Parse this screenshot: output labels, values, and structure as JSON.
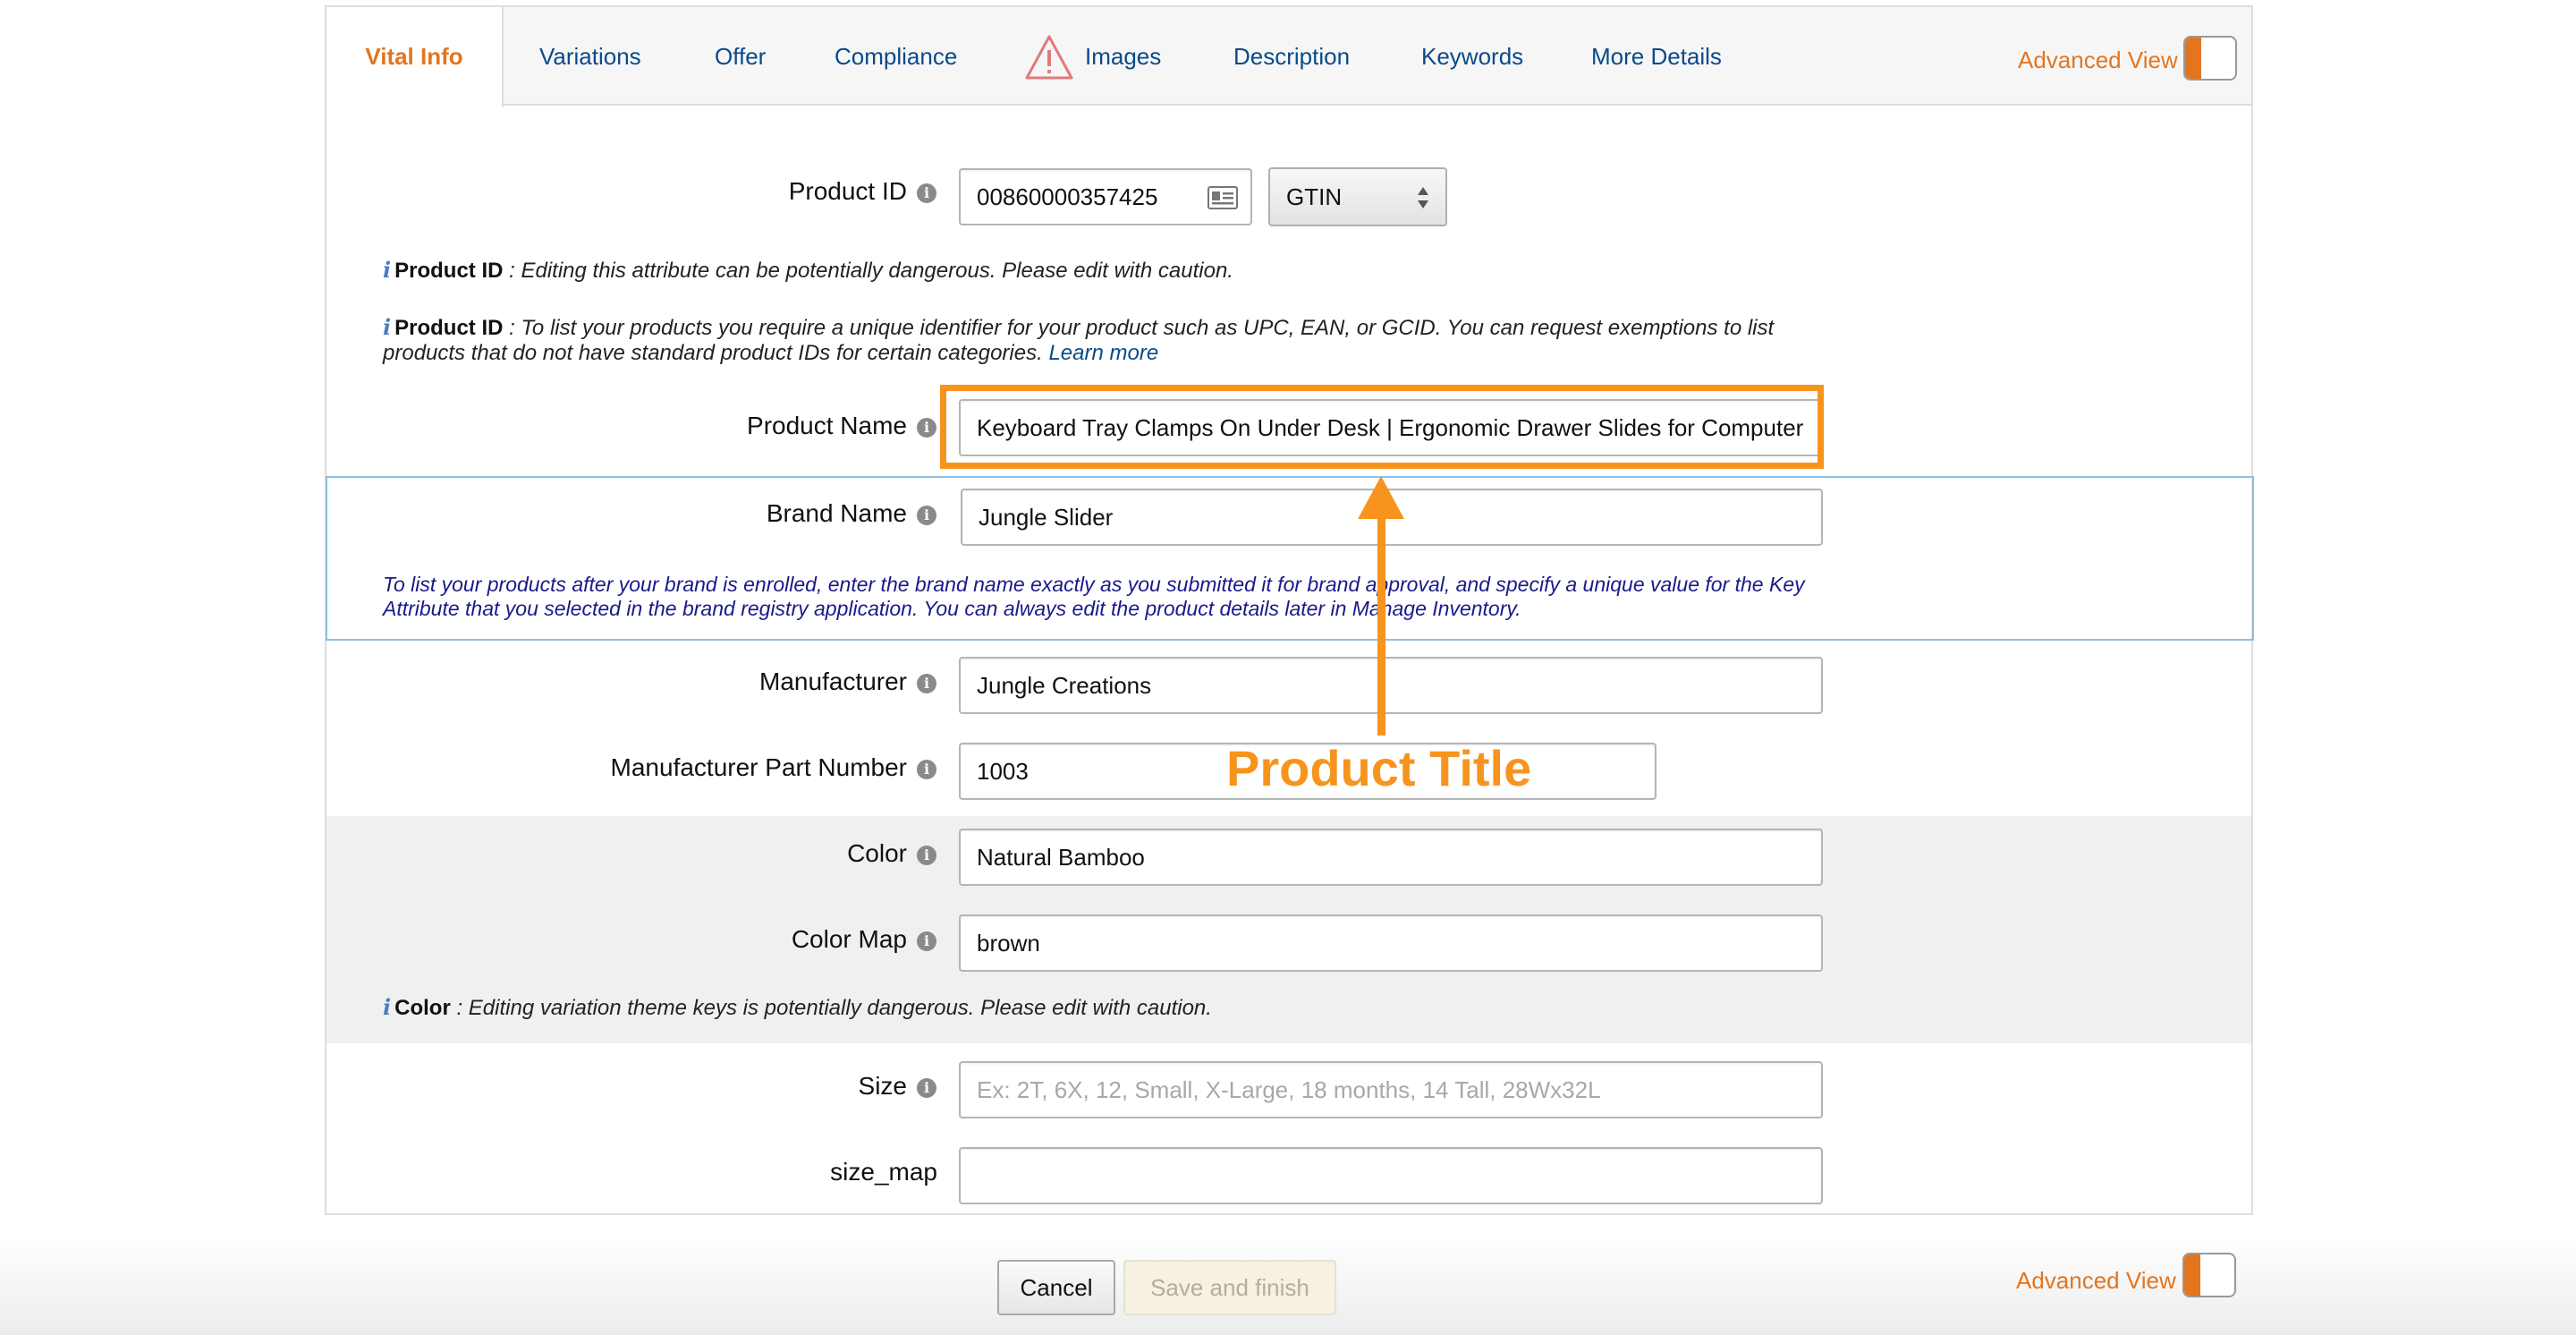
{
  "tabs": [
    {
      "label": "Vital Info",
      "active": true
    },
    {
      "label": "Variations"
    },
    {
      "label": "Offer"
    },
    {
      "label": "Compliance"
    },
    {
      "label": "Images",
      "icon": "warning-icon"
    },
    {
      "label": "Description"
    },
    {
      "label": "Keywords"
    },
    {
      "label": "More Details"
    }
  ],
  "advanced_view": {
    "label": "Advanced View",
    "enabled": true
  },
  "form": {
    "product_id": {
      "label": "Product ID",
      "value": "00860000357425",
      "type_value": "GTIN"
    },
    "product_id_note_1": {
      "heading": "Product ID",
      "text": " : Editing this attribute can be potentially dangerous. Please edit with caution."
    },
    "product_id_note_2": {
      "heading": "Product ID",
      "text": " : To list your products you require a unique identifier for your product such as UPC, EAN, or GCID. You can request exemptions to list products that do not have standard product IDs for certain categories.",
      "link": "Learn more"
    },
    "product_name": {
      "label": "Product Name",
      "value": "Keyboard Tray Clamps On Under Desk | Ergonomic Drawer Slides for Computer"
    },
    "brand_name": {
      "label": "Brand Name",
      "value": "Jungle Slider"
    },
    "brand_note": "To list your products after your brand is enrolled, enter the brand name exactly as you submitted it for brand approval, and specify a unique value for the Key Attribute that you selected in the brand registry application. You can always edit the product details later in Manage Inventory.",
    "manufacturer": {
      "label": "Manufacturer",
      "value": "Jungle Creations"
    },
    "part_number": {
      "label": "Manufacturer Part Number",
      "value": "1003"
    },
    "color": {
      "label": "Color",
      "value": "Natural Bamboo"
    },
    "color_map": {
      "label": "Color Map",
      "value": "brown"
    },
    "color_note": {
      "heading": "Color",
      "text": " : Editing variation theme keys is potentially dangerous. Please edit with caution."
    },
    "size": {
      "label": "Size",
      "placeholder": "Ex: 2T, 6X, 12, Small, X-Large, 18 months, 14 Tall, 28Wx32L"
    },
    "size_map": {
      "label": "size_map",
      "value": ""
    }
  },
  "annotation": {
    "label": "Product Title",
    "color": "#f7941d"
  },
  "footer": {
    "cancel_label": "Cancel",
    "save_label": "Save and finish"
  },
  "colors": {
    "accent": "#e3751f",
    "link": "#0a4a8a",
    "highlight": "#f7941d"
  }
}
